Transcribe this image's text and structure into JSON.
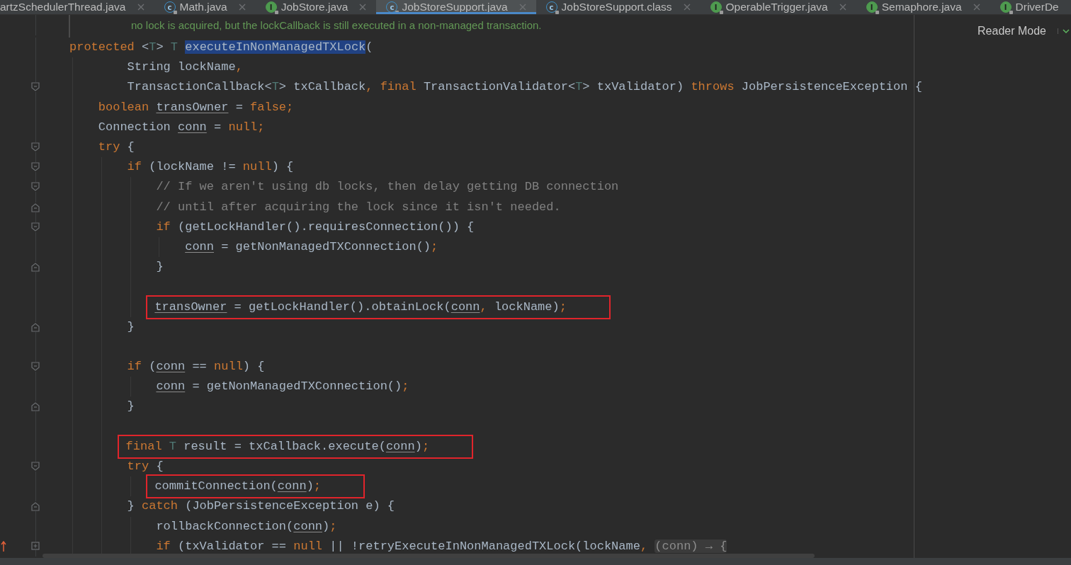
{
  "tabs": [
    {
      "label": "artzSchedulerThread.java",
      "kind": "none",
      "selected": false,
      "closable": true
    },
    {
      "label": "Math.java",
      "kind": "class",
      "icon": "c",
      "selected": false,
      "closable": true
    },
    {
      "label": "JobStore.java",
      "kind": "interface",
      "icon": "I",
      "selected": false,
      "closable": true
    },
    {
      "label": "JobStoreSupport.java",
      "kind": "class",
      "icon": "c",
      "selected": true,
      "closable": true
    },
    {
      "label": "JobStoreSupport.class",
      "kind": "class",
      "icon": "c",
      "selected": false,
      "closable": true
    },
    {
      "label": "OperableTrigger.java",
      "kind": "interface",
      "icon": "I",
      "selected": false,
      "closable": true
    },
    {
      "label": "Semaphore.java",
      "kind": "interface",
      "icon": "I",
      "selected": false,
      "closable": true
    },
    {
      "label": "DriverDe",
      "kind": "interface",
      "icon": "I",
      "selected": false,
      "closable": false
    }
  ],
  "editor": {
    "doc_comment": "no lock is acquired, but the lockCallback is still executed in a non-managed transaction.",
    "reader_mode": "Reader Mode",
    "lines": [
      {
        "kind": "code",
        "tokens": [
          {
            "text": "protected ",
            "kind": "kw"
          },
          {
            "text": "<",
            "kind": "plain"
          },
          {
            "text": "T",
            "kind": "tp"
          },
          {
            "text": "> ",
            "kind": "plain"
          },
          {
            "text": "T ",
            "kind": "tp"
          },
          {
            "text": "executeInNonManagedTXLock",
            "kind": "decl"
          },
          {
            "text": "(",
            "kind": "plain"
          }
        ],
        "children": [
          {
            "kind": "continuation",
            "tokens": [
              {
                "text": "String lockName",
                "kind": "plain"
              },
              {
                "text": ",",
                "kind": "punct"
              }
            ]
          },
          {
            "kind": "continuation",
            "fold": {
              "kind": "start"
            },
            "tokens": [
              {
                "text": "TransactionCallback<",
                "kind": "plain"
              },
              {
                "text": "T",
                "kind": "tp"
              },
              {
                "text": "> txCallback",
                "kind": "plain"
              },
              {
                "text": ", ",
                "kind": "punct"
              },
              {
                "text": "final ",
                "kind": "kw"
              },
              {
                "text": "TransactionValidator<",
                "kind": "plain"
              },
              {
                "text": "T",
                "kind": "tp"
              },
              {
                "text": "> txValidator) ",
                "kind": "plain"
              },
              {
                "text": "throws ",
                "kind": "kw"
              },
              {
                "text": "JobPersistenceException {",
                "kind": "plain"
              }
            ]
          },
          {
            "kind": "code",
            "tokens": [
              {
                "text": "boolean ",
                "kind": "kw"
              },
              {
                "text": "transOwner",
                "kind": "var"
              },
              {
                "text": " = ",
                "kind": "plain"
              },
              {
                "text": "false;",
                "kind": "kw"
              }
            ]
          },
          {
            "kind": "code",
            "tokens": [
              {
                "text": "Connection ",
                "kind": "plain"
              },
              {
                "text": "conn",
                "kind": "var"
              },
              {
                "text": " = ",
                "kind": "plain"
              },
              {
                "text": "null;",
                "kind": "kw"
              }
            ]
          },
          {
            "kind": "code",
            "fold": {
              "kind": "start"
            },
            "tokens": [
              {
                "text": "try ",
                "kind": "kw"
              },
              {
                "text": "{",
                "kind": "plain"
              }
            ],
            "children": [
              {
                "kind": "code",
                "fold": {
                  "kind": "start"
                },
                "tokens": [
                  {
                    "text": "if ",
                    "kind": "kw"
                  },
                  {
                    "text": "(lockName != ",
                    "kind": "plain"
                  },
                  {
                    "text": "null",
                    "kind": "kw"
                  },
                  {
                    "text": ") {",
                    "kind": "plain"
                  }
                ],
                "children": [
                  {
                    "kind": "code",
                    "fold": {
                      "kind": "start"
                    },
                    "tokens": [
                      {
                        "text": "// If we aren't using db locks, then delay getting DB connection",
                        "kind": "comment"
                      }
                    ]
                  },
                  {
                    "kind": "code",
                    "fold": {
                      "kind": "end"
                    },
                    "tokens": [
                      {
                        "text": "// until after acquiring the lock since it isn't needed.",
                        "kind": "comment"
                      }
                    ]
                  },
                  {
                    "kind": "code",
                    "fold": {
                      "kind": "start"
                    },
                    "tokens": [
                      {
                        "text": "if ",
                        "kind": "kw"
                      },
                      {
                        "text": "(getLockHandler().requiresConnection()) {",
                        "kind": "plain"
                      }
                    ],
                    "children": [
                      {
                        "kind": "code",
                        "tokens": [
                          {
                            "text": "conn",
                            "kind": "var"
                          },
                          {
                            "text": " = getNonManagedTXConnection()",
                            "kind": "plain"
                          },
                          {
                            "text": ";",
                            "kind": "punct"
                          }
                        ]
                      }
                    ]
                  },
                  {
                    "kind": "code",
                    "fold": {
                      "kind": "end"
                    },
                    "tokens": [
                      {
                        "text": "}",
                        "kind": "plain"
                      }
                    ]
                  },
                  {
                    "kind": "blank"
                  },
                  {
                    "kind": "code",
                    "boxed": true,
                    "tokens": [
                      {
                        "text": "transOwner",
                        "kind": "var"
                      },
                      {
                        "text": " = getLockHandler().obtainLock(",
                        "kind": "plain"
                      },
                      {
                        "text": "conn",
                        "kind": "var"
                      },
                      {
                        "text": ", ",
                        "kind": "punct"
                      },
                      {
                        "text": "lockName)",
                        "kind": "plain"
                      },
                      {
                        "text": ";",
                        "kind": "punct"
                      }
                    ]
                  }
                ]
              },
              {
                "kind": "code",
                "fold": {
                  "kind": "end"
                },
                "tokens": [
                  {
                    "text": "}",
                    "kind": "plain"
                  }
                ]
              },
              {
                "kind": "blank"
              },
              {
                "kind": "code",
                "fold": {
                  "kind": "start"
                },
                "tokens": [
                  {
                    "text": "if ",
                    "kind": "kw"
                  },
                  {
                    "text": "(",
                    "kind": "plain"
                  },
                  {
                    "text": "conn",
                    "kind": "var"
                  },
                  {
                    "text": " == ",
                    "kind": "plain"
                  },
                  {
                    "text": "null",
                    "kind": "kw"
                  },
                  {
                    "text": ") {",
                    "kind": "plain"
                  }
                ],
                "children": [
                  {
                    "kind": "code",
                    "tokens": [
                      {
                        "text": "conn",
                        "kind": "var"
                      },
                      {
                        "text": " = getNonManagedTXConnection()",
                        "kind": "plain"
                      },
                      {
                        "text": ";",
                        "kind": "punct"
                      }
                    ]
                  }
                ]
              },
              {
                "kind": "code",
                "fold": {
                  "kind": "end"
                },
                "tokens": [
                  {
                    "text": "}",
                    "kind": "plain"
                  }
                ]
              },
              {
                "kind": "blank"
              },
              {
                "kind": "code",
                "boxed": true,
                "tokens": [
                  {
                    "text": "final ",
                    "kind": "kw"
                  },
                  {
                    "text": "T ",
                    "kind": "tp"
                  },
                  {
                    "text": "result = txCallback.execute(",
                    "kind": "plain"
                  },
                  {
                    "text": "conn",
                    "kind": "var"
                  },
                  {
                    "text": ")",
                    "kind": "plain"
                  },
                  {
                    "text": ";",
                    "kind": "punct"
                  }
                ]
              },
              {
                "kind": "code",
                "fold": {
                  "kind": "start"
                },
                "tokens": [
                  {
                    "text": "try ",
                    "kind": "kw"
                  },
                  {
                    "text": "{",
                    "kind": "plain"
                  }
                ],
                "children": [
                  {
                    "kind": "code",
                    "boxed": true,
                    "tokens": [
                      {
                        "text": "commitConnection(",
                        "kind": "plain"
                      },
                      {
                        "text": "conn",
                        "kind": "var"
                      },
                      {
                        "text": ")",
                        "kind": "plain"
                      },
                      {
                        "text": ";",
                        "kind": "punct"
                      }
                    ]
                  }
                ]
              },
              {
                "kind": "code",
                "fold": {
                  "kind": "end"
                },
                "tokens": [
                  {
                    "text": "} ",
                    "kind": "plain"
                  },
                  {
                    "text": "catch ",
                    "kind": "kw"
                  },
                  {
                    "text": "(JobPersistenceException e) {",
                    "kind": "plain"
                  }
                ],
                "children": [
                  {
                    "kind": "code",
                    "tokens": [
                      {
                        "text": "rollbackConnection(",
                        "kind": "plain"
                      },
                      {
                        "text": "conn",
                        "kind": "var"
                      },
                      {
                        "text": ")",
                        "kind": "plain"
                      },
                      {
                        "text": ";",
                        "kind": "punct"
                      }
                    ]
                  },
                  {
                    "kind": "code",
                    "fold": {
                      "kind": "collapsed"
                    },
                    "tokens": [
                      {
                        "text": "if ",
                        "kind": "kw"
                      },
                      {
                        "text": "(txValidator == ",
                        "kind": "plain"
                      },
                      {
                        "text": "null ",
                        "kind": "kw"
                      },
                      {
                        "text": "|| !retryExecuteInNonManagedTXLock(lockName",
                        "kind": "plain"
                      },
                      {
                        "text": ", ",
                        "kind": "punct"
                      },
                      {
                        "text": "(conn) → {",
                        "kind": "hint"
                      }
                    ]
                  }
                ]
              }
            ]
          }
        ]
      }
    ]
  }
}
